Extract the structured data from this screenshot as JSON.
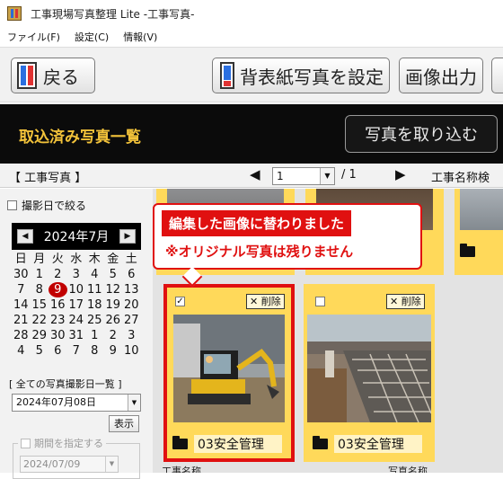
{
  "window": {
    "title": "工事現場写真整理 Lite -工事写真-"
  },
  "menu": {
    "items": [
      "ファイル(F)",
      "設定(C)",
      "情報(V)"
    ]
  },
  "toolbar": {
    "back_label": "戻る",
    "cover_label": "背表紙写真を設定",
    "output_label": "画像出力"
  },
  "header": {
    "title": "取込済み写真一覧",
    "import_label": "写真を取り込む"
  },
  "pager": {
    "category": "【 工事写真 】",
    "page": "1",
    "total": "/ 1",
    "search_label": "工事名称検"
  },
  "sidebar": {
    "shoot_filter_label": "撮影日で絞る",
    "calendar": {
      "title": "2024年7月",
      "weekdays": [
        "日",
        "月",
        "火",
        "水",
        "木",
        "金",
        "土"
      ],
      "days": [
        "30",
        "1",
        "2",
        "3",
        "4",
        "5",
        "6",
        "7",
        "8",
        "9",
        "10",
        "11",
        "12",
        "13",
        "14",
        "15",
        "16",
        "17",
        "18",
        "19",
        "20",
        "21",
        "22",
        "23",
        "24",
        "25",
        "26",
        "27",
        "28",
        "29",
        "30",
        "31",
        "1",
        "2",
        "3",
        "4",
        "5",
        "6",
        "7",
        "8",
        "9",
        "10"
      ],
      "selected_index": 9
    },
    "all_dates_label": "[ 全ての写真撮影日一覧 ]",
    "date_value": "2024年07月08日",
    "show_label": "表示",
    "period_label": "期間を指定する",
    "period_from": "2024/07/09"
  },
  "cards": [
    {
      "folder": "03安全管理",
      "delete_label": "削除",
      "checked": true,
      "caption": "工事名称"
    },
    {
      "folder": "03安全管理",
      "delete_label": "削除",
      "checked": false,
      "caption": "写真名称"
    }
  ],
  "callout": {
    "line1": "編集した画像に替わりました",
    "line2": "※オリジナル写真は残りません"
  },
  "colors": {
    "accent": "#e01010",
    "header_bg": "#0b0b0b",
    "header_text": "#f3c33a",
    "card": "#ffd95a"
  }
}
